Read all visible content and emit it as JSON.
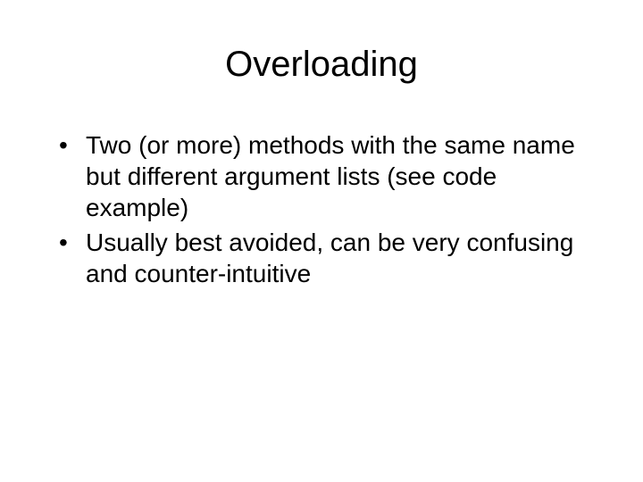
{
  "slide": {
    "title": "Overloading",
    "bullets": [
      "Two (or more) methods with the same name but different argument lists (see code example)",
      "Usually best avoided, can be very confusing and counter-intuitive"
    ]
  }
}
